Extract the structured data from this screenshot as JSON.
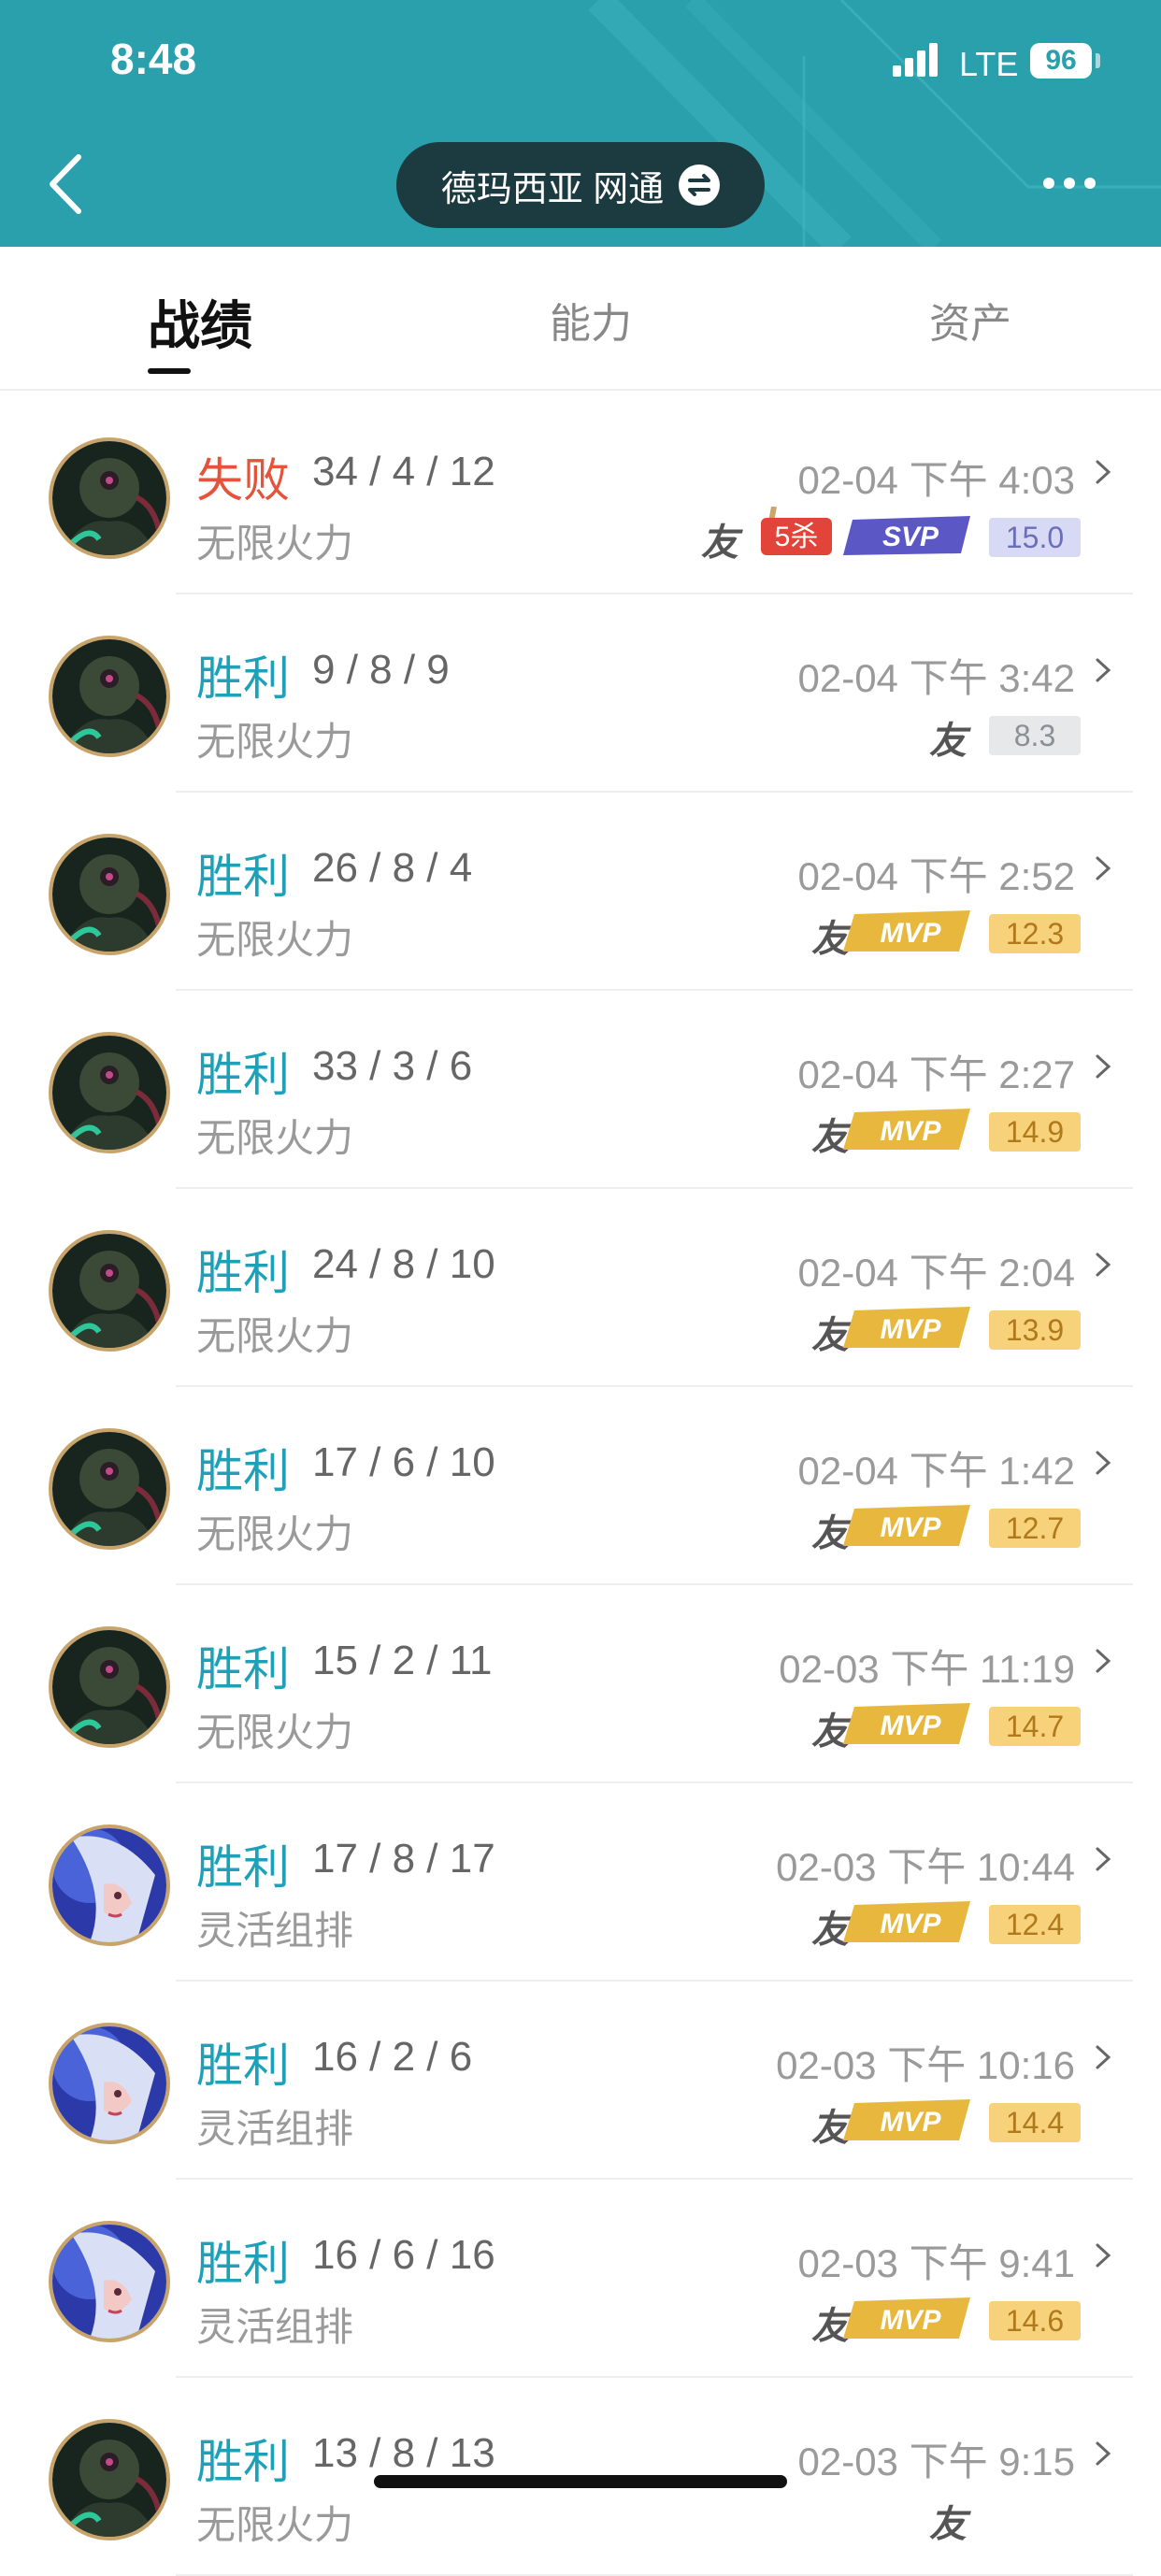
{
  "status_bar": {
    "time": "8:48",
    "network": "LTE",
    "battery": "96"
  },
  "header": {
    "server_label": "德玛西亚 网通"
  },
  "tabs": [
    {
      "label": "战绩"
    },
    {
      "label": "能力"
    },
    {
      "label": "资产"
    }
  ],
  "matches": [
    {
      "result": "失败",
      "kda": "34 / 4 / 12",
      "mode": "无限火力",
      "time": "02-04 下午 4:03",
      "you": "友",
      "badges": [
        "5杀",
        "SVP"
      ],
      "score": "15.0",
      "score_type": "svp",
      "avatar": "dark"
    },
    {
      "result": "胜利",
      "kda": "9 / 8 / 9",
      "mode": "无限火力",
      "time": "02-04 下午 3:42",
      "you": "友",
      "badges": [],
      "score": "8.3",
      "score_type": "plain",
      "avatar": "dark"
    },
    {
      "result": "胜利",
      "kda": "26 / 8 / 4",
      "mode": "无限火力",
      "time": "02-04 下午 2:52",
      "you": "友",
      "badges": [
        "MVP"
      ],
      "score": "12.3",
      "score_type": "mvp",
      "avatar": "dark"
    },
    {
      "result": "胜利",
      "kda": "33 / 3 / 6",
      "mode": "无限火力",
      "time": "02-04 下午 2:27",
      "you": "友",
      "badges": [
        "MVP"
      ],
      "score": "14.9",
      "score_type": "mvp",
      "avatar": "dark"
    },
    {
      "result": "胜利",
      "kda": "24 / 8 / 10",
      "mode": "无限火力",
      "time": "02-04 下午 2:04",
      "you": "友",
      "badges": [
        "MVP"
      ],
      "score": "13.9",
      "score_type": "mvp",
      "avatar": "dark"
    },
    {
      "result": "胜利",
      "kda": "17 / 6 / 10",
      "mode": "无限火力",
      "time": "02-04 下午 1:42",
      "you": "友",
      "badges": [
        "MVP"
      ],
      "score": "12.7",
      "score_type": "mvp",
      "avatar": "dark"
    },
    {
      "result": "胜利",
      "kda": "15 / 2 / 11",
      "mode": "无限火力",
      "time": "02-03 下午 11:19",
      "you": "友",
      "badges": [
        "MVP"
      ],
      "score": "14.7",
      "score_type": "mvp",
      "avatar": "dark"
    },
    {
      "result": "胜利",
      "kda": "17 / 8 / 17",
      "mode": "灵活组排",
      "time": "02-03 下午 10:44",
      "you": "友",
      "badges": [
        "MVP"
      ],
      "score": "12.4",
      "score_type": "mvp",
      "avatar": "blue"
    },
    {
      "result": "胜利",
      "kda": "16 / 2 / 6",
      "mode": "灵活组排",
      "time": "02-03 下午 10:16",
      "you": "友",
      "badges": [
        "MVP"
      ],
      "score": "14.4",
      "score_type": "mvp",
      "avatar": "blue"
    },
    {
      "result": "胜利",
      "kda": "16 / 6 / 16",
      "mode": "灵活组排",
      "time": "02-03 下午 9:41",
      "you": "友",
      "badges": [
        "MVP"
      ],
      "score": "14.6",
      "score_type": "mvp",
      "avatar": "blue"
    },
    {
      "result": "胜利",
      "kda": "13 / 8 / 13",
      "mode": "无限火力",
      "time": "02-03 下午 9:15",
      "you": "友",
      "badges": [],
      "score": "",
      "score_type": "plain",
      "avatar": "dark"
    }
  ],
  "colors": {
    "win": "#1ea1b8",
    "loss": "#e4533b",
    "header_bg": "#2aa0ad"
  }
}
